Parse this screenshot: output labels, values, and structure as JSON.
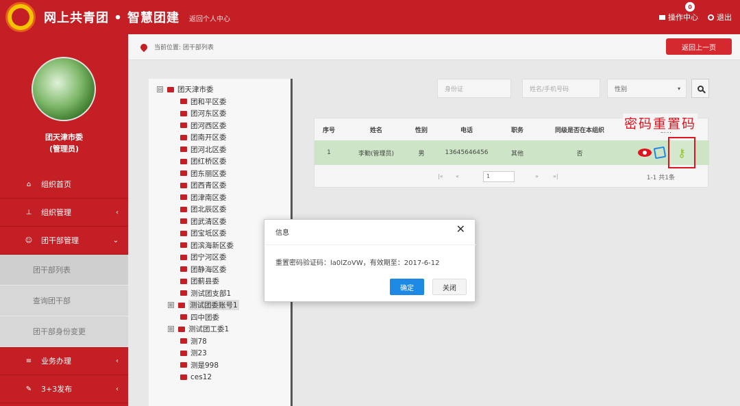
{
  "header": {
    "brand": "网上共青团 • 智慧团建",
    "back_link": "返回个人中心",
    "ops_center": "操作中心",
    "ops_badge": "0",
    "logout": "退出"
  },
  "sidebar": {
    "user_name": "团天津市委",
    "user_role": "(管理员)",
    "items": [
      {
        "label": "组织首页",
        "icon": "home-icon"
      },
      {
        "label": "组织管理",
        "icon": "org-icon",
        "chevron": "‹"
      },
      {
        "label": "团干部管理",
        "icon": "people-icon",
        "chevron": "⌄"
      },
      {
        "label": "团干部列表",
        "sub": true
      },
      {
        "label": "查询团干部",
        "sub": true
      },
      {
        "label": "团干部身份变更",
        "sub": true
      },
      {
        "label": "业务办理",
        "icon": "list-icon",
        "chevron": "‹"
      },
      {
        "label": "3+3发布",
        "icon": "edit-icon",
        "chevron": "‹"
      }
    ]
  },
  "breadcrumb": {
    "text": "当前位置: 团干部列表",
    "back_button": "返回上一页"
  },
  "tree": [
    {
      "label": "团天津市委",
      "level": 0,
      "toggle": "⊟"
    },
    {
      "label": "团和平区委",
      "level": 1
    },
    {
      "label": "团河东区委",
      "level": 1
    },
    {
      "label": "团河西区委",
      "level": 1
    },
    {
      "label": "团南开区委",
      "level": 1
    },
    {
      "label": "团河北区委",
      "level": 1
    },
    {
      "label": "团红桥区委",
      "level": 1
    },
    {
      "label": "团东丽区委",
      "level": 1
    },
    {
      "label": "团西青区委",
      "level": 1
    },
    {
      "label": "团津南区委",
      "level": 1
    },
    {
      "label": "团北辰区委",
      "level": 1
    },
    {
      "label": "团武清区委",
      "level": 1
    },
    {
      "label": "团宝坻区委",
      "level": 1
    },
    {
      "label": "团滨海新区委",
      "level": 1
    },
    {
      "label": "团宁河区委",
      "level": 1
    },
    {
      "label": "团静海区委",
      "level": 1
    },
    {
      "label": "团蓟县委",
      "level": 1
    },
    {
      "label": "测试团支部1",
      "level": 1
    },
    {
      "label": "测试团委账号1",
      "level": 1,
      "toggle": "⊞",
      "selected": true
    },
    {
      "label": "四中团委",
      "level": 1
    },
    {
      "label": "测试团工委1",
      "level": 1,
      "toggle": "⊞"
    },
    {
      "label": "测78",
      "level": 1
    },
    {
      "label": "测23",
      "level": 1
    },
    {
      "label": "测是998",
      "level": 1
    },
    {
      "label": "ces12",
      "level": 1
    }
  ],
  "filters": {
    "id_placeholder": "身份证",
    "name_placeholder": "姓名/手机号码",
    "gender_select": "性别",
    "caret": "▾"
  },
  "table": {
    "columns": [
      "序号",
      "姓名",
      "性别",
      "电话",
      "职务",
      "同级是否在本组织",
      "操作"
    ],
    "rows": [
      {
        "index": "1",
        "name": "李勤(管理员)",
        "gender": "男",
        "phone": "13645646456",
        "title": "其他",
        "same_level": "否"
      }
    ],
    "pager": {
      "first": "|«",
      "prev": "«",
      "page": "1",
      "next": "»",
      "last": "»|",
      "info": "1-1  共1条"
    }
  },
  "annotation": "密码重置码",
  "modal": {
    "title": "信息",
    "close": "✕",
    "message": "重置密码验证码：la0lZoVW，有效期至：2017-6-12",
    "ok": "确定",
    "cancel": "关闭"
  },
  "colors": {
    "brand_red": "#c51f26",
    "confirm_blue": "#1e88e5",
    "highlight_green": "#cde4c6"
  }
}
